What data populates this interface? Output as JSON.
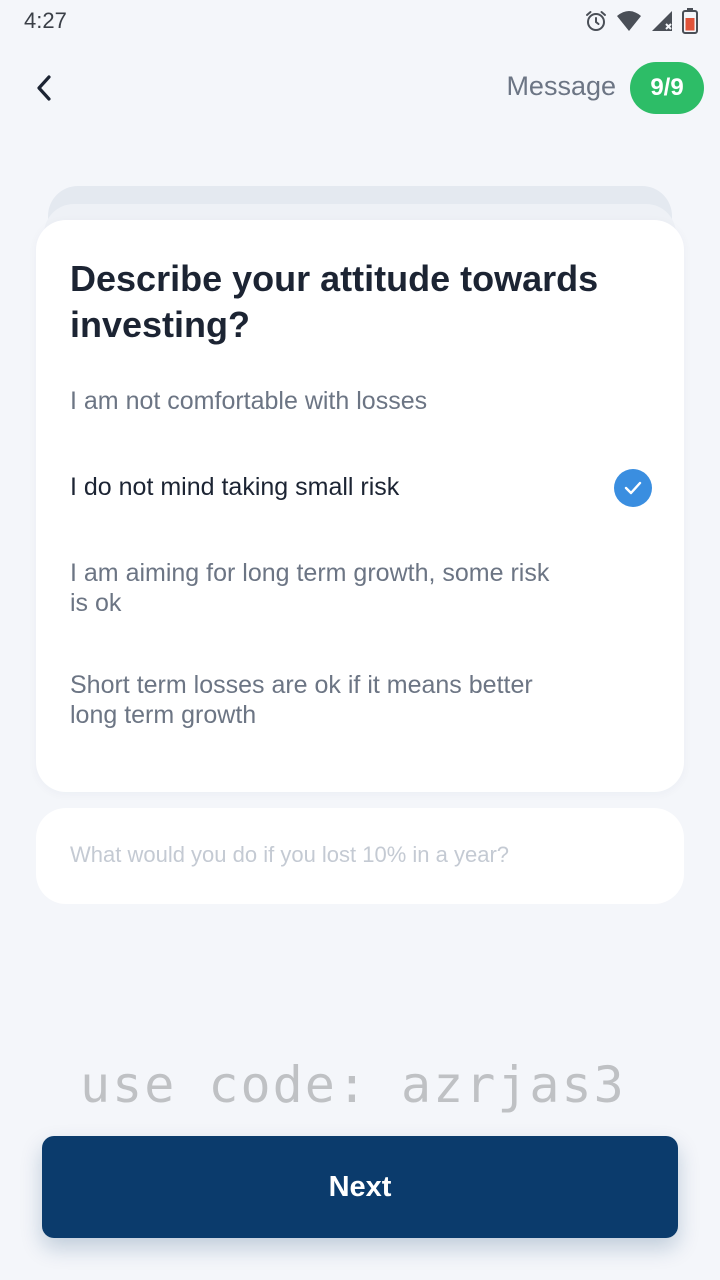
{
  "status_bar": {
    "time": "4:27",
    "icons": [
      "alarm-icon",
      "wifi-icon",
      "signal-icon",
      "battery-icon"
    ]
  },
  "header": {
    "back_icon": "chevron-left-icon",
    "label": "Message",
    "progress": "9/9",
    "progress_color": "#2dbd67"
  },
  "question": {
    "title": "Describe your attitude towards investing?",
    "options": [
      {
        "label": "I am not comfortable with losses",
        "selected": false
      },
      {
        "label": "I do not mind taking small risk",
        "selected": true
      },
      {
        "label": "I am aiming for long term growth, some risk is ok",
        "selected": false
      },
      {
        "label": "Short term losses are ok if it means better long term growth",
        "selected": false
      }
    ],
    "selected_color": "#3a8ee0"
  },
  "next_question": {
    "text": "What would you do if you lost 10% in a year?"
  },
  "watermark": "use code: azrjas3",
  "next_button": {
    "label": "Next",
    "color": "#0b3b6c"
  }
}
